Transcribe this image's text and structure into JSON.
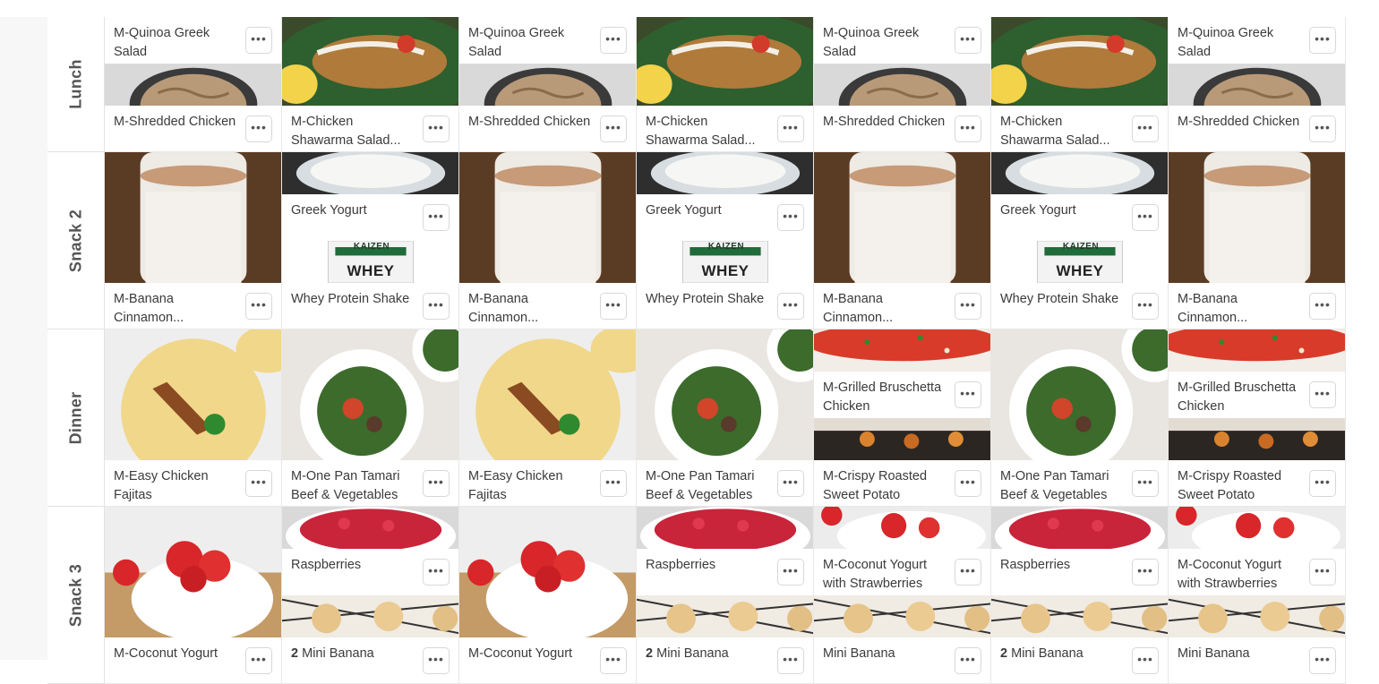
{
  "rows": [
    {
      "label": "Lunch",
      "cells": [
        {
          "type": "double",
          "top": {
            "title": "M-Quinoa Greek Salad",
            "img": "chicken"
          },
          "bottom": {
            "title": "M-Shredded Chicken"
          }
        },
        {
          "type": "single",
          "img": "salad",
          "title": "M-Chicken Shawarma Salad..."
        },
        {
          "type": "double",
          "top": {
            "title": "M-Quinoa Greek Salad",
            "img": "chicken"
          },
          "bottom": {
            "title": "M-Shredded Chicken"
          }
        },
        {
          "type": "single",
          "img": "salad",
          "title": "M-Chicken Shawarma Salad..."
        },
        {
          "type": "double",
          "top": {
            "title": "M-Quinoa Greek Salad",
            "img": "chicken"
          },
          "bottom": {
            "title": "M-Shredded Chicken"
          }
        },
        {
          "type": "single",
          "img": "salad",
          "title": "M-Chicken Shawarma Salad..."
        },
        {
          "type": "double",
          "top": {
            "title": "M-Quinoa Greek Salad",
            "img": "chicken"
          },
          "bottom": {
            "title": "M-Shredded Chicken"
          }
        }
      ]
    },
    {
      "label": "Snack 2",
      "cells": [
        {
          "type": "single",
          "img": "smoothie",
          "title": "M-Banana Cinnamon..."
        },
        {
          "type": "double",
          "topImg": "yogurt",
          "top": {
            "title": "Greek Yogurt",
            "img": "whey",
            "brand": "KAIZEN",
            "product": "WHEY"
          },
          "bottom": {
            "title": "Whey Protein Shake"
          }
        },
        {
          "type": "single",
          "img": "smoothie",
          "title": "M-Banana Cinnamon..."
        },
        {
          "type": "double",
          "topImg": "yogurt",
          "top": {
            "title": "Greek Yogurt",
            "img": "whey",
            "brand": "KAIZEN",
            "product": "WHEY"
          },
          "bottom": {
            "title": "Whey Protein Shake"
          }
        },
        {
          "type": "single",
          "img": "smoothie",
          "title": "M-Banana Cinnamon..."
        },
        {
          "type": "double",
          "topImg": "yogurt",
          "top": {
            "title": "Greek Yogurt",
            "img": "whey",
            "brand": "KAIZEN",
            "product": "WHEY"
          },
          "bottom": {
            "title": "Whey Protein Shake"
          }
        },
        {
          "type": "single",
          "img": "smoothie",
          "title": "M-Banana Cinnamon..."
        }
      ]
    },
    {
      "label": "Dinner",
      "cells": [
        {
          "type": "single",
          "img": "fajita",
          "title": "M-Easy Chicken Fajitas"
        },
        {
          "type": "single",
          "img": "beefbowl",
          "title": "M-One Pan Tamari Beef & Vegetables"
        },
        {
          "type": "single",
          "img": "fajita",
          "title": "M-Easy Chicken Fajitas"
        },
        {
          "type": "single",
          "img": "beefbowl",
          "title": "M-One Pan Tamari Beef & Vegetables"
        },
        {
          "type": "double",
          "topImg": "bruschetta",
          "top": {
            "title": "M-Grilled Bruschetta Chicken",
            "img": "sweetpotato"
          },
          "bottom": {
            "title": "M-Crispy Roasted Sweet Potato"
          }
        },
        {
          "type": "single",
          "img": "beefbowl",
          "title": "M-One Pan Tamari Beef & Vegetables"
        },
        {
          "type": "double",
          "topImg": "bruschetta",
          "top": {
            "title": "M-Grilled Bruschetta Chicken",
            "img": "sweetpotato"
          },
          "bottom": {
            "title": "M-Crispy Roasted Sweet Potato"
          }
        }
      ]
    },
    {
      "label": "Snack 3",
      "cells": [
        {
          "type": "single",
          "img": "strawyog",
          "title": "M-Coconut Yogurt"
        },
        {
          "type": "double",
          "topImg": "raspberry",
          "top": {
            "title": "Raspberries",
            "img": "muffins"
          },
          "bottom": {
            "qty": "2",
            "title": "Mini Banana"
          }
        },
        {
          "type": "single",
          "img": "strawyog",
          "title": "M-Coconut Yogurt"
        },
        {
          "type": "double",
          "topImg": "raspberry",
          "top": {
            "title": "Raspberries",
            "img": "muffins"
          },
          "bottom": {
            "qty": "2",
            "title": "Mini Banana"
          }
        },
        {
          "type": "double",
          "topImg": "strawsmall",
          "top": {
            "title": "M-Coconut Yogurt with Strawberries",
            "img": "muffins"
          },
          "bottom": {
            "title": "Mini Banana"
          }
        },
        {
          "type": "double",
          "topImg": "raspberry",
          "top": {
            "title": "Raspberries",
            "img": "muffins"
          },
          "bottom": {
            "qty": "2",
            "title": "Mini Banana"
          }
        },
        {
          "type": "double",
          "topImg": "strawsmall",
          "top": {
            "title": "M-Coconut Yogurt with Strawberries",
            "img": "muffins"
          },
          "bottom": {
            "title": "Mini Banana"
          }
        }
      ]
    }
  ],
  "more_button_symbol": "•••",
  "colors": {
    "border": "#e3e3e3",
    "text": "#3b3b3b",
    "label": "#555555",
    "gutter": "#f7f7f7"
  }
}
